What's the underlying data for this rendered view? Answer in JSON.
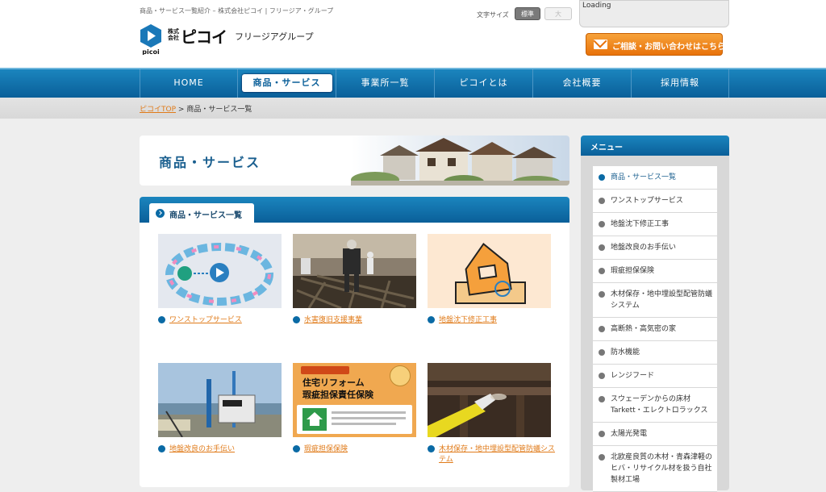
{
  "header": {
    "tagline": "商品・サービス一覧紹介 – 株式会社ピコイ | フリージア・グループ",
    "logo_kaisha": "株式会社",
    "logo_name": "ピコイ",
    "logo_group": "フリージアグループ",
    "logo_mark_text": "picoi",
    "font_size_label": "文字サイズ",
    "font_size_standard": "標準",
    "font_size_large": "大",
    "loading_text": "Loading",
    "contact_label": "ご相談・お問い合わせはこちら"
  },
  "nav": {
    "items": [
      {
        "label": "HOME"
      },
      {
        "label": "商品・サービス"
      },
      {
        "label": "事業所一覧"
      },
      {
        "label": "ピコイとは"
      },
      {
        "label": "会社概要"
      },
      {
        "label": "採用情報"
      }
    ]
  },
  "breadcrumb": {
    "home": "ピコイTOP",
    "separator": ">",
    "current": "商品・サービス一覧"
  },
  "banner": {
    "title": "商品・サービス"
  },
  "panel": {
    "title": "商品・サービス一覧",
    "cards": [
      {
        "caption": "ワンストップサービス"
      },
      {
        "caption": "水害復旧支援事業"
      },
      {
        "caption": "地盤沈下修正工事"
      },
      {
        "caption": "地盤改良のお手伝い"
      },
      {
        "caption": "瑕疵担保保険",
        "thumb_text_1": "住宅リフォーム",
        "thumb_text_2": "瑕疵担保責任保険"
      },
      {
        "caption": "木材保存・地中埋設型配管防蟻システム"
      }
    ]
  },
  "sidebar": {
    "title": "メニュー",
    "items": [
      {
        "label": "商品・サービス一覧"
      },
      {
        "label": "ワンストップサービス"
      },
      {
        "label": "地盤沈下修正工事"
      },
      {
        "label": "地盤改良のお手伝い"
      },
      {
        "label": "瑕疵担保保険"
      },
      {
        "label": "木材保存・地中埋設型配管防蟻システム"
      },
      {
        "label": "高断熱・高気密の家"
      },
      {
        "label": "防水機能"
      },
      {
        "label": "レンジフード"
      },
      {
        "label": "スウェーデンからの床材 Tarkett・エレクトロラックス"
      },
      {
        "label": "太陽光発電"
      },
      {
        "label": "北欧産良質の木材・青森津軽のヒバ・リサイクル材を扱う自社製材工場"
      }
    ]
  },
  "colors": {
    "brand_blue": "#0a5f99",
    "accent_orange": "#e8720a",
    "link_orange": "#e07b1a"
  }
}
